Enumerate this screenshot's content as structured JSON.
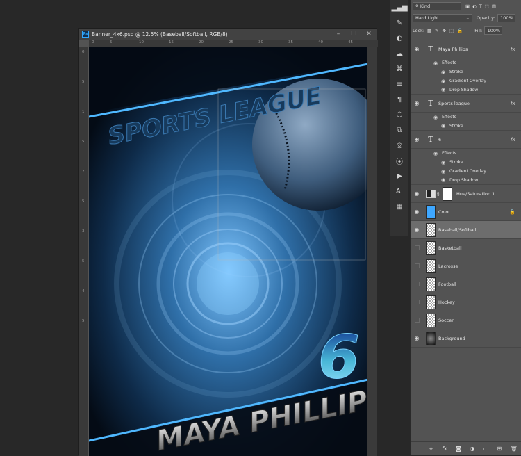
{
  "document": {
    "title": "Banner_4x6.psd @ 12.5% (Baseball/Softball, RGB/8)",
    "ps_badge": "Ps",
    "ruler_h_labels": [
      "0",
      "5",
      "10",
      "15",
      "20",
      "25",
      "30",
      "35",
      "40",
      "45"
    ],
    "ruler_v_labels": [
      "0",
      "5",
      "1",
      "5",
      "2",
      "5",
      "3",
      "5",
      "4",
      "5"
    ]
  },
  "canvas": {
    "headline": "SPORTS LEAGUE",
    "number": "6",
    "name": "MAYA PHILLIPS"
  },
  "panel": {
    "filter_kind": "Kind",
    "blend_mode": "Hard Light",
    "opacity_label": "Opacity:",
    "opacity_value": "100%",
    "lock_label": "Lock:",
    "fill_label": "Fill:",
    "fill_value": "100%",
    "effects_label": "Effects",
    "layers": [
      {
        "name": "Maya Phillips",
        "kind": "type",
        "effects": [
          "Stroke",
          "Gradient Overlay",
          "Drop Shadow"
        ]
      },
      {
        "name": "Sports league",
        "kind": "type",
        "effects": [
          "Stroke"
        ]
      },
      {
        "name": "6",
        "kind": "type",
        "effects": [
          "Stroke",
          "Gradient Overlay",
          "Drop Shadow"
        ]
      },
      {
        "name": "Hue/Saturation 1",
        "kind": "adjustment"
      },
      {
        "name": "Color",
        "kind": "fill",
        "locked": true
      },
      {
        "name": "Baseball/Softball",
        "kind": "pixel",
        "selected": true
      },
      {
        "name": "Basketball",
        "kind": "pixel",
        "hidden": true
      },
      {
        "name": "Lacrosse",
        "kind": "pixel",
        "hidden": true
      },
      {
        "name": "Football",
        "kind": "pixel",
        "hidden": true
      },
      {
        "name": "Hockey",
        "kind": "pixel",
        "hidden": true
      },
      {
        "name": "Soccer",
        "kind": "pixel",
        "hidden": true
      },
      {
        "name": "Background",
        "kind": "pixel"
      }
    ]
  },
  "colors": {
    "accent_blue": "#4fb8ff",
    "selection": "#6d6d6d"
  }
}
